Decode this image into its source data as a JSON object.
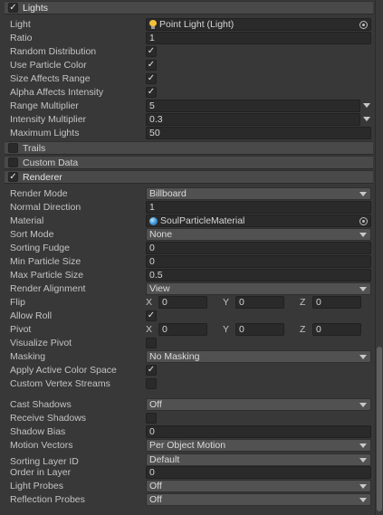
{
  "sections": {
    "lights": "Lights",
    "trails": "Trails",
    "custom_data": "Custom Data",
    "renderer": "Renderer"
  },
  "check_mark": "✓",
  "lights": {
    "light_label": "Light",
    "light_value": "Point Light (Light)",
    "ratio_label": "Ratio",
    "ratio_value": "1",
    "random_distribution_label": "Random Distribution",
    "use_particle_color_label": "Use Particle Color",
    "size_affects_range_label": "Size Affects Range",
    "alpha_affects_intensity_label": "Alpha Affects Intensity",
    "range_multiplier_label": "Range Multiplier",
    "range_multiplier_value": "5",
    "intensity_multiplier_label": "Intensity Multiplier",
    "intensity_multiplier_value": "0.3",
    "maximum_lights_label": "Maximum Lights",
    "maximum_lights_value": "50"
  },
  "renderer": {
    "render_mode_label": "Render Mode",
    "render_mode_value": "Billboard",
    "normal_direction_label": "Normal Direction",
    "normal_direction_value": "1",
    "material_label": "Material",
    "material_value": "SoulParticleMaterial",
    "sort_mode_label": "Sort Mode",
    "sort_mode_value": "None",
    "sorting_fudge_label": "Sorting Fudge",
    "sorting_fudge_value": "0",
    "min_particle_size_label": "Min Particle Size",
    "min_particle_size_value": "0",
    "max_particle_size_label": "Max Particle Size",
    "max_particle_size_value": "0.5",
    "render_alignment_label": "Render Alignment",
    "render_alignment_value": "View",
    "flip_label": "Flip",
    "flip": {
      "x": "0",
      "y": "0",
      "z": "0"
    },
    "allow_roll_label": "Allow Roll",
    "pivot_label": "Pivot",
    "pivot": {
      "x": "0",
      "y": "0",
      "z": "0"
    },
    "axis_x": "X",
    "axis_y": "Y",
    "axis_z": "Z",
    "visualize_pivot_label": "Visualize Pivot",
    "masking_label": "Masking",
    "masking_value": "No Masking",
    "apply_active_color_space_label": "Apply Active Color Space",
    "custom_vertex_streams_label": "Custom Vertex Streams",
    "cast_shadows_label": "Cast Shadows",
    "cast_shadows_value": "Off",
    "receive_shadows_label": "Receive Shadows",
    "shadow_bias_label": "Shadow Bias",
    "shadow_bias_value": "0",
    "motion_vectors_label": "Motion Vectors",
    "motion_vectors_value": "Per Object Motion",
    "sorting_layer_id_label": "Sorting Layer ID",
    "sorting_layer_id_value": "Default",
    "order_in_layer_label": "Order in Layer",
    "order_in_layer_value": "0",
    "light_probes_label": "Light Probes",
    "light_probes_value": "Off",
    "reflection_probes_label": "Reflection Probes",
    "reflection_probes_value": "Off"
  }
}
